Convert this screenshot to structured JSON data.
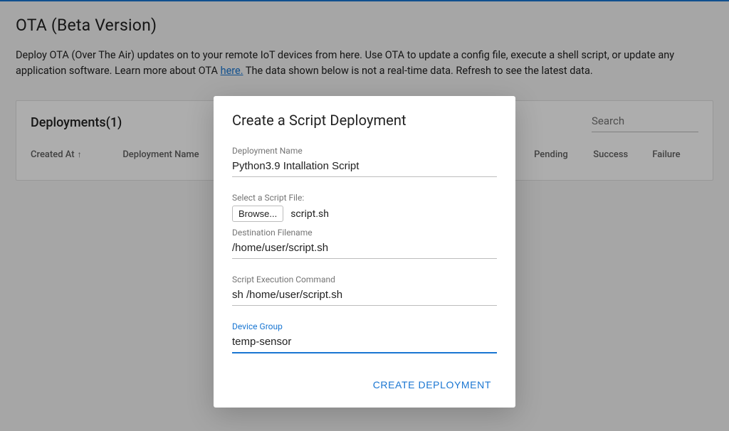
{
  "page": {
    "title": "OTA (Beta Version)",
    "description_pre": "Deploy OTA (Over The Air) updates on to your remote IoT devices from here. Use OTA to update a config file, execute a shell script, or update any application software. Learn more about OTA ",
    "description_link": "here.",
    "description_post": " The data shown below is not a real-time data. Refresh to see the latest data."
  },
  "panel": {
    "title": "Deployments(1)",
    "search_placeholder": "Search",
    "columns": {
      "created_at": "Created At",
      "deployment_name": "Deployment Name",
      "pending": "Pending",
      "success": "Success",
      "failure": "Failure"
    }
  },
  "dialog": {
    "title": "Create a Script Deployment",
    "fields": {
      "deployment_name": {
        "label": "Deployment Name",
        "value": "Python3.9 Intallation Script"
      },
      "script_file": {
        "label": "Select a Script File:",
        "browse": "Browse...",
        "filename": "script.sh"
      },
      "destination": {
        "label": "Destination Filename",
        "value": "/home/user/script.sh"
      },
      "exec_command": {
        "label": "Script Execution Command",
        "value": "sh /home/user/script.sh"
      },
      "device_group": {
        "label": "Device Group",
        "value": "temp-sensor"
      }
    },
    "action": "CREATE DEPLOYMENT"
  }
}
